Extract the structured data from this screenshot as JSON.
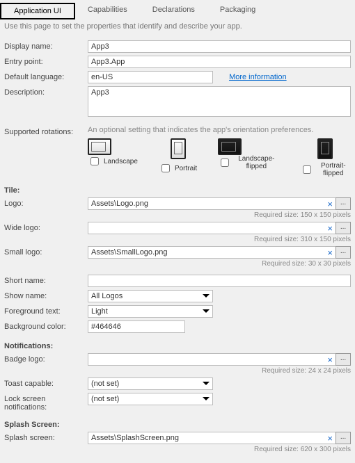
{
  "tabs": {
    "app_ui": "Application UI",
    "capabilities": "Capabilities",
    "declarations": "Declarations",
    "packaging": "Packaging"
  },
  "page_description": "Use this page to set the properties that identify and describe your app.",
  "labels": {
    "display_name": "Display name:",
    "entry_point": "Entry point:",
    "default_language": "Default language:",
    "description": "Description:",
    "supported_rotations": "Supported rotations:",
    "tile": "Tile:",
    "logo": "Logo:",
    "wide_logo": "Wide logo:",
    "small_logo": "Small logo:",
    "short_name": "Short name:",
    "show_name": "Show name:",
    "foreground_text": "Foreground text:",
    "background_color": "Background color:",
    "notifications": "Notifications:",
    "badge_logo": "Badge logo:",
    "toast_capable": "Toast capable:",
    "lock_screen": "Lock screen notifications:",
    "splash_section": "Splash Screen:",
    "splash_screen": "Splash screen:"
  },
  "values": {
    "display_name": "App3",
    "entry_point": "App3.App",
    "default_language": "en-US",
    "description": "App3",
    "logo": "Assets\\Logo.png",
    "wide_logo": "",
    "small_logo": "Assets\\SmallLogo.png",
    "short_name": "",
    "show_name": "All Logos",
    "foreground_text": "Light",
    "background_color": "#464646",
    "badge_logo": "",
    "toast_capable": "(not set)",
    "lock_screen": "(not set)",
    "splash_screen": "Assets\\SplashScreen.png"
  },
  "rotations_hint": "An optional setting that indicates the app's orientation preferences.",
  "rotations": {
    "landscape": "Landscape",
    "portrait": "Portrait",
    "landscape_flipped": "Landscape-flipped",
    "portrait_flipped": "Portrait-flipped"
  },
  "more_info": "More information",
  "required_sizes": {
    "logo": "Required size: 150 x 150 pixels",
    "wide_logo": "Required size: 310 x 150 pixels",
    "small_logo": "Required size: 30 x 30 pixels",
    "badge_logo": "Required size: 24 x 24 pixels",
    "splash": "Required size: 620 x 300 pixels"
  },
  "buttons": {
    "browse": "...",
    "clear": "×"
  }
}
